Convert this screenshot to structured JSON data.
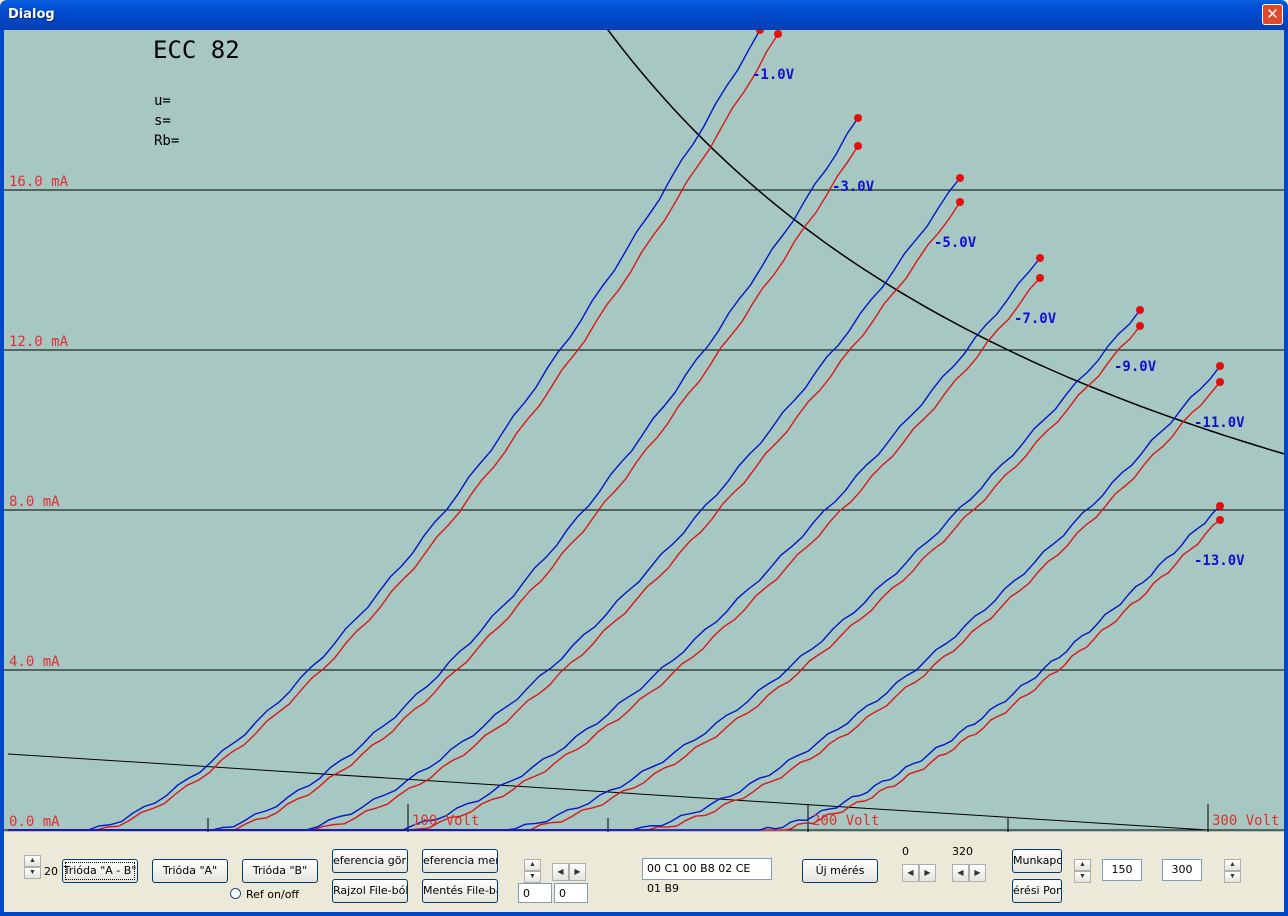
{
  "window": {
    "title": "Dialog",
    "close": "✕"
  },
  "chart_data": {
    "type": "line",
    "title": "ECC 82",
    "params": {
      "u": "u=",
      "s": "s=",
      "rb": "Rb="
    },
    "xlabel": "Volt",
    "ylabel": "mA",
    "xlim": [
      0,
      320
    ],
    "ylim": [
      0,
      20
    ],
    "y_ticks": [
      "0.0 mA",
      "4.0 mA",
      "8.0 mA",
      "12.0 mA",
      "16.0 mA"
    ],
    "y_tick_values": [
      0,
      4,
      8,
      12,
      16
    ],
    "x_ticks": [
      "100 Volt",
      "200 Volt",
      "300 Volt"
    ],
    "x_tick_values": [
      100,
      200,
      300
    ],
    "colors": {
      "blue": "#0018c8",
      "red": "#d81818",
      "grid": "#000000",
      "axis_label": "#e03030",
      "curve_label": "#1010d0"
    },
    "series": [
      {
        "name": "-1.0V",
        "grid_voltage": -1.0,
        "blue": {
          "v0": 20,
          "v_end": 188,
          "i_end": 20.0
        },
        "red": {
          "v0": 22,
          "v_end": 192.5,
          "i_end": 19.9
        }
      },
      {
        "name": "-3.0V",
        "grid_voltage": -3.0,
        "blue": {
          "v0": 51,
          "v_end": 212.5,
          "i_end": 17.8
        },
        "red": {
          "v0": 54,
          "v_end": 212.5,
          "i_end": 17.1
        }
      },
      {
        "name": "-5.0V",
        "grid_voltage": -5.0,
        "blue": {
          "v0": 72,
          "v_end": 238,
          "i_end": 16.3
        },
        "red": {
          "v0": 76,
          "v_end": 238,
          "i_end": 15.7
        }
      },
      {
        "name": "-7.0V",
        "grid_voltage": -7.0,
        "blue": {
          "v0": 96,
          "v_end": 258,
          "i_end": 14.3
        },
        "red": {
          "v0": 100,
          "v_end": 258,
          "i_end": 13.8
        }
      },
      {
        "name": "-9.0V",
        "grid_voltage": -9.0,
        "blue": {
          "v0": 124,
          "v_end": 283,
          "i_end": 13.0
        },
        "red": {
          "v0": 128,
          "v_end": 283,
          "i_end": 12.6
        }
      },
      {
        "name": "-11.0V",
        "grid_voltage": -11.0,
        "blue": {
          "v0": 156,
          "v_end": 303,
          "i_end": 11.6
        },
        "red": {
          "v0": 160,
          "v_end": 303,
          "i_end": 11.2
        }
      },
      {
        "name": "-13.0V",
        "grid_voltage": -13.0,
        "blue": {
          "v0": 188,
          "v_end": 303,
          "i_end": 8.1
        },
        "red": {
          "v0": 192,
          "v_end": 303,
          "i_end": 7.75
        }
      }
    ],
    "load_line": {
      "v0": 0,
      "i0": 2.0,
      "v1": 300,
      "i1": 0.0
    },
    "power_curve": {
      "note": "max dissipation hyperbola",
      "product_w": 3.0
    }
  },
  "controls": {
    "spin_value": "20",
    "trioda_ab": "Trióda \"A - B\"",
    "trioda_a": "Trióda  \"A\"",
    "trioda_b": "Trióda  \"B\"",
    "ref_onoff": "Ref on/off",
    "ref_gorbe": "eferencia görb",
    "rajzol_file": "Rajzol File-ból",
    "ref_mentes": "eferencia ment",
    "mentes_file": "Mentés File-ba",
    "field_a": "0",
    "field_b": "0",
    "hex_data": "00 C1 00 B8 02 CE 01 B9",
    "uj_meres": "Új mérés",
    "range_min": "0",
    "range_max": "320",
    "munkapont": "Munkapon",
    "meresi_pont": "érési Pont",
    "val_150": "150",
    "val_300": "300"
  }
}
